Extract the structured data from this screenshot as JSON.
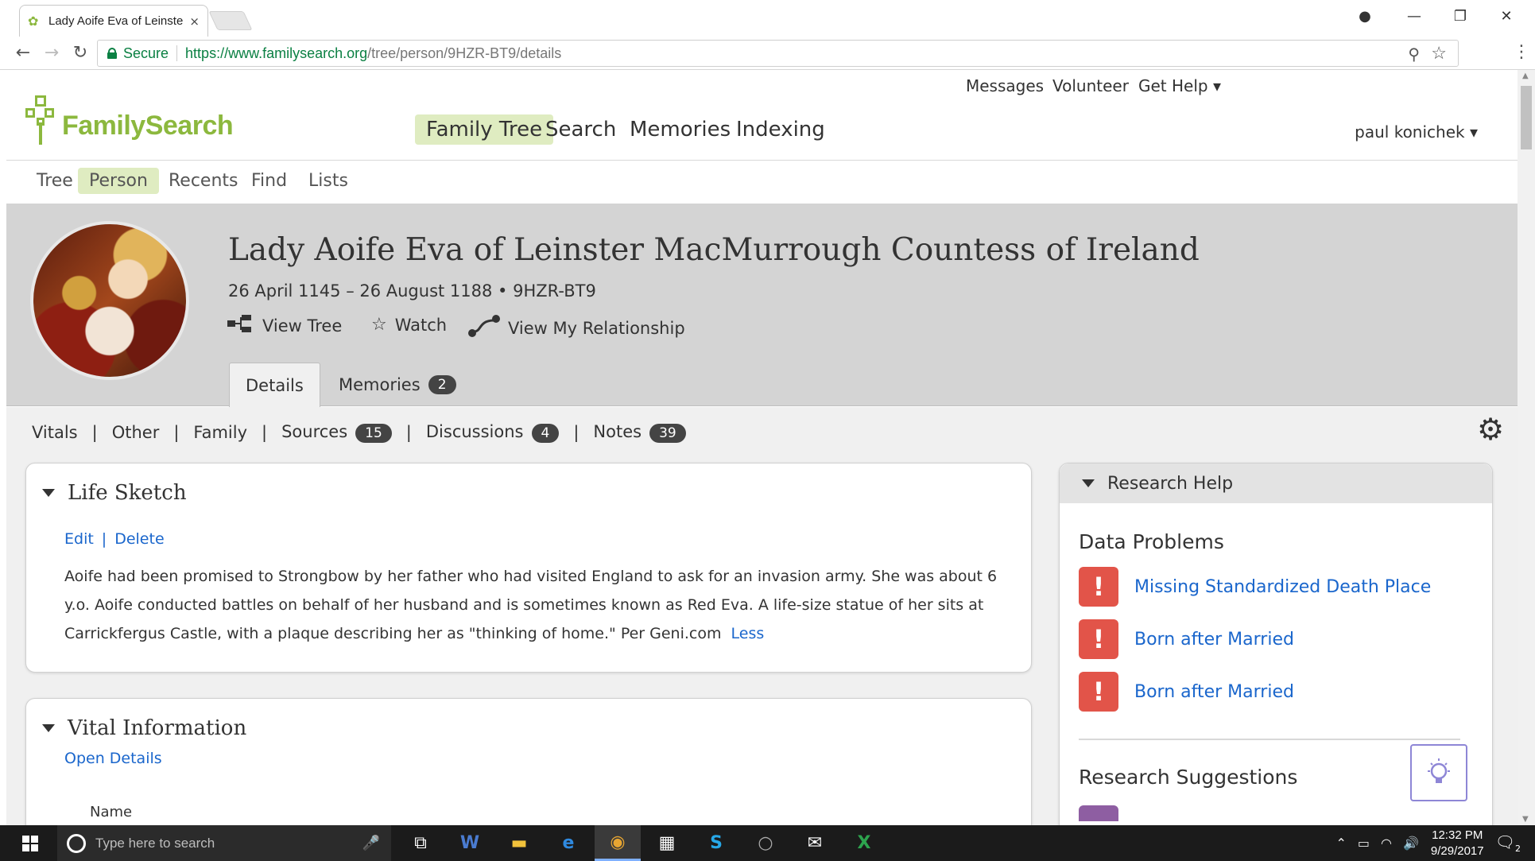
{
  "browser": {
    "tab_title": "Lady Aoife Eva of Leinste",
    "tab_close": "×",
    "secure_label": "Secure",
    "url_scheme_host": "https://www.familysearch.org",
    "url_path": "/tree/person/9HZR-BT9/details",
    "back": "←",
    "forward": "→",
    "reload": "↻",
    "zoom": "⚲",
    "star": "☆",
    "win_account": "●",
    "win_min": "—",
    "win_restore": "❐",
    "win_close": "✕"
  },
  "header": {
    "logo_text": "FamilySearch",
    "utility": {
      "messages": "Messages",
      "volunteer": "Volunteer",
      "get_help": "Get Help ▾"
    },
    "nav": [
      "Family Tree",
      "Search",
      "Memories",
      "Indexing"
    ],
    "user": "paul konichek ▾"
  },
  "sub_nav": [
    "Tree",
    "Person",
    "Recents",
    "Find",
    "Lists"
  ],
  "person": {
    "name": "Lady Aoife Eva of Leinster MacMurrough Countess of Ireland",
    "dates_id": "26 April 1145 – 26 August 1188 • 9HZR-BT9",
    "actions": {
      "view_tree": "View Tree",
      "watch": "Watch",
      "view_relationship": "View My Relationship"
    },
    "tabs": {
      "details": "Details",
      "memories": "Memories",
      "memories_count": "2"
    }
  },
  "section_nav": {
    "vitals": "Vitals",
    "other": "Other",
    "family": "Family",
    "sources": "Sources",
    "sources_count": "15",
    "discussions": "Discussions",
    "discussions_count": "4",
    "notes": "Notes",
    "notes_count": "39",
    "sep": "|"
  },
  "life_sketch": {
    "title": "Life Sketch",
    "edit": "Edit",
    "delete": "Delete",
    "text": "Aoife had been promised to Strongbow by her father who had visited England to ask for an invasion army. She was about 6 y.o. Aoife conducted battles on behalf of her husband and is sometimes known as Red Eva. A life-size statue of her sits at Carrickfergus Castle, with a plaque describing her as \"thinking of home.\" Per Geni.com",
    "less": "Less"
  },
  "vital_information": {
    "title": "Vital Information",
    "open_details": "Open Details",
    "name_label": "Name"
  },
  "research_help": {
    "title": "Research Help",
    "data_problems_title": "Data Problems",
    "problems": [
      "Missing Standardized Death Place",
      "Born after Married",
      "Born after Married"
    ],
    "alert_glyph": "!",
    "suggestions_title": "Research Suggestions"
  },
  "taskbar": {
    "search_placeholder": "Type here to search",
    "time": "12:32 PM",
    "date": "9/29/2017",
    "notifications_count": "2"
  },
  "colors": {
    "brand_green": "#8cb83e",
    "nav_active_bg": "#dfecc1",
    "link_blue": "#1a66cc",
    "alert_red": "#e25449",
    "banner_gray": "#d4d4d4"
  }
}
